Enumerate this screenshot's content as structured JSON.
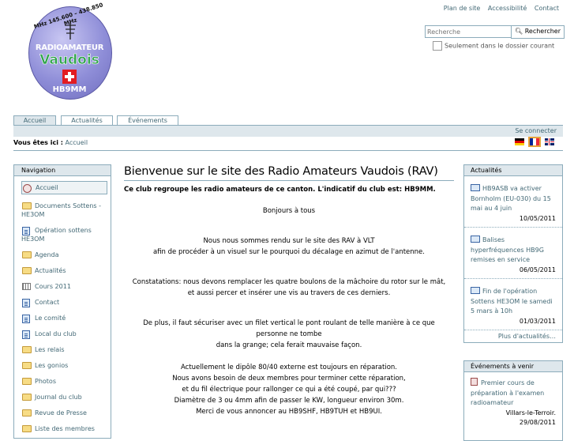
{
  "logo": {
    "frequency": "MHz 145.600 – 438.850 MHz",
    "line1": "RADIOAMATEUR",
    "line2": "Vaudois",
    "callsign": "HB9MM"
  },
  "site_actions": [
    "Plan de site",
    "Accessibilité",
    "Contact"
  ],
  "search": {
    "placeholder": "Recherche",
    "button": "Rechercher",
    "option": "Seulement dans le dossier courant"
  },
  "tabs": [
    "Accueil",
    "Actualités",
    "Événements"
  ],
  "login": "Se connecter",
  "breadcrumb": {
    "label": "Vous êtes ici :",
    "current": "Accueil"
  },
  "navigation": {
    "title": "Navigation",
    "items": [
      {
        "label": "Accueil",
        "icon": "home-icon"
      },
      {
        "label": "Documents Sottens - HE3OM",
        "icon": "folder-icon"
      },
      {
        "label": "Opération sottens HE3OM",
        "icon": "document-icon"
      },
      {
        "label": "Agenda",
        "icon": "folder-icon"
      },
      {
        "label": "Actualités",
        "icon": "folder-icon"
      },
      {
        "label": "Cours 2011",
        "icon": "collection-icon"
      },
      {
        "label": "Contact",
        "icon": "document-icon"
      },
      {
        "label": "Le comité",
        "icon": "document-icon"
      },
      {
        "label": "Local du club",
        "icon": "document-icon"
      },
      {
        "label": "Les relais",
        "icon": "folder-icon"
      },
      {
        "label": "Les gonios",
        "icon": "folder-icon"
      },
      {
        "label": "Photos",
        "icon": "folder-icon"
      },
      {
        "label": "Journal du club",
        "icon": "folder-icon"
      },
      {
        "label": "Revue de Presse",
        "icon": "folder-icon"
      },
      {
        "label": "Liste des membres",
        "icon": "folder-icon"
      }
    ]
  },
  "main": {
    "title": "Bienvenue sur le site des Radio Amateurs Vaudois (RAV)",
    "lead": "Ce club regroupe les radio amateurs de ce canton. L'indicatif du club est: HB9MM.",
    "greeting": "Bonjours à tous",
    "p1_l1": "Nous nous sommes rendu sur le site des RAV à VLT",
    "p1_l2": "afin de procéder à un visuel sur le pourquoi du décalage en azimut de l'antenne.",
    "p2_l1": "Constatations: nous devons remplacer les quatre boulons de la mâchoire du rotor sur le mât,",
    "p2_l2": "et aussi percer et  insérer une vis au travers de ces derniers.",
    "p3_l1": "De plus, il faut sécuriser avec un filet vertical le pont roulant de telle manière à ce que",
    "p3_l2": "personne ne tombe",
    "p3_l3": "dans la grange; cela ferait mauvaise façon.",
    "p4_l1": "Actuellement le dipôle 80/40 externe est toujours en réparation.",
    "p4_l2": "Nous avons besoin de deux membres pour terminer cette réparation,",
    "p4_l3": "et du fil électrique pour rallonger ce qui a été coupé, par qui???",
    "p4_l4": "Diamètre de 3 ou 4mm afin de passer le KW, longueur environ 30m.",
    "p4_l5": "Merci de vous annoncer au HB9SHF, HB9TUH et HB9UI."
  },
  "news": {
    "title": "Actualités",
    "items": [
      {
        "title": "HB9ASB va activer Bornholm (EU-030) du 15 mai au 4 juin",
        "date": "10/05/2011"
      },
      {
        "title": "Balises hyperfréquences HB9G remises en service",
        "date": "06/05/2011"
      },
      {
        "title": "Fin de l'opération Sottens HE3OM le samedi 5 mars à 10h",
        "date": "01/03/2011"
      }
    ],
    "more": "Plus d'actualités…"
  },
  "events": {
    "title": "Événements à venir",
    "items": [
      {
        "title": "Premier cours de préparation à l'examen radioamateur",
        "location": "Villars-le-Terroir.",
        "date": "29/08/2011"
      }
    ]
  },
  "colors": {
    "accent": "#436976",
    "border": "#8cacbb",
    "header_bg": "#dee7ec"
  }
}
